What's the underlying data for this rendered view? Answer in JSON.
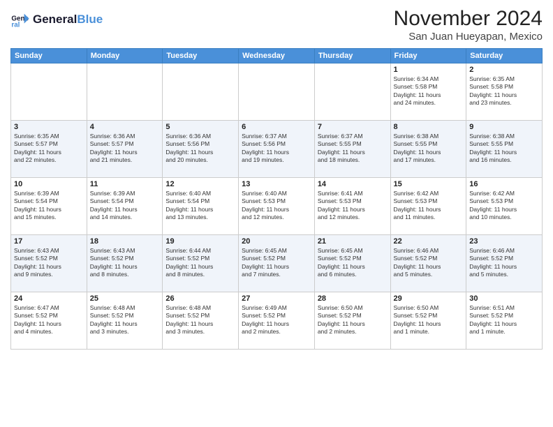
{
  "header": {
    "logo_line1": "General",
    "logo_line2": "Blue",
    "month": "November 2024",
    "location": "San Juan Hueyapan, Mexico"
  },
  "days_of_week": [
    "Sunday",
    "Monday",
    "Tuesday",
    "Wednesday",
    "Thursday",
    "Friday",
    "Saturday"
  ],
  "weeks": [
    [
      {
        "day": "",
        "info": ""
      },
      {
        "day": "",
        "info": ""
      },
      {
        "day": "",
        "info": ""
      },
      {
        "day": "",
        "info": ""
      },
      {
        "day": "",
        "info": ""
      },
      {
        "day": "1",
        "info": "Sunrise: 6:34 AM\nSunset: 5:58 PM\nDaylight: 11 hours\nand 24 minutes."
      },
      {
        "day": "2",
        "info": "Sunrise: 6:35 AM\nSunset: 5:58 PM\nDaylight: 11 hours\nand 23 minutes."
      }
    ],
    [
      {
        "day": "3",
        "info": "Sunrise: 6:35 AM\nSunset: 5:57 PM\nDaylight: 11 hours\nand 22 minutes."
      },
      {
        "day": "4",
        "info": "Sunrise: 6:36 AM\nSunset: 5:57 PM\nDaylight: 11 hours\nand 21 minutes."
      },
      {
        "day": "5",
        "info": "Sunrise: 6:36 AM\nSunset: 5:56 PM\nDaylight: 11 hours\nand 20 minutes."
      },
      {
        "day": "6",
        "info": "Sunrise: 6:37 AM\nSunset: 5:56 PM\nDaylight: 11 hours\nand 19 minutes."
      },
      {
        "day": "7",
        "info": "Sunrise: 6:37 AM\nSunset: 5:55 PM\nDaylight: 11 hours\nand 18 minutes."
      },
      {
        "day": "8",
        "info": "Sunrise: 6:38 AM\nSunset: 5:55 PM\nDaylight: 11 hours\nand 17 minutes."
      },
      {
        "day": "9",
        "info": "Sunrise: 6:38 AM\nSunset: 5:55 PM\nDaylight: 11 hours\nand 16 minutes."
      }
    ],
    [
      {
        "day": "10",
        "info": "Sunrise: 6:39 AM\nSunset: 5:54 PM\nDaylight: 11 hours\nand 15 minutes."
      },
      {
        "day": "11",
        "info": "Sunrise: 6:39 AM\nSunset: 5:54 PM\nDaylight: 11 hours\nand 14 minutes."
      },
      {
        "day": "12",
        "info": "Sunrise: 6:40 AM\nSunset: 5:54 PM\nDaylight: 11 hours\nand 13 minutes."
      },
      {
        "day": "13",
        "info": "Sunrise: 6:40 AM\nSunset: 5:53 PM\nDaylight: 11 hours\nand 12 minutes."
      },
      {
        "day": "14",
        "info": "Sunrise: 6:41 AM\nSunset: 5:53 PM\nDaylight: 11 hours\nand 12 minutes."
      },
      {
        "day": "15",
        "info": "Sunrise: 6:42 AM\nSunset: 5:53 PM\nDaylight: 11 hours\nand 11 minutes."
      },
      {
        "day": "16",
        "info": "Sunrise: 6:42 AM\nSunset: 5:53 PM\nDaylight: 11 hours\nand 10 minutes."
      }
    ],
    [
      {
        "day": "17",
        "info": "Sunrise: 6:43 AM\nSunset: 5:52 PM\nDaylight: 11 hours\nand 9 minutes."
      },
      {
        "day": "18",
        "info": "Sunrise: 6:43 AM\nSunset: 5:52 PM\nDaylight: 11 hours\nand 8 minutes."
      },
      {
        "day": "19",
        "info": "Sunrise: 6:44 AM\nSunset: 5:52 PM\nDaylight: 11 hours\nand 8 minutes."
      },
      {
        "day": "20",
        "info": "Sunrise: 6:45 AM\nSunset: 5:52 PM\nDaylight: 11 hours\nand 7 minutes."
      },
      {
        "day": "21",
        "info": "Sunrise: 6:45 AM\nSunset: 5:52 PM\nDaylight: 11 hours\nand 6 minutes."
      },
      {
        "day": "22",
        "info": "Sunrise: 6:46 AM\nSunset: 5:52 PM\nDaylight: 11 hours\nand 5 minutes."
      },
      {
        "day": "23",
        "info": "Sunrise: 6:46 AM\nSunset: 5:52 PM\nDaylight: 11 hours\nand 5 minutes."
      }
    ],
    [
      {
        "day": "24",
        "info": "Sunrise: 6:47 AM\nSunset: 5:52 PM\nDaylight: 11 hours\nand 4 minutes."
      },
      {
        "day": "25",
        "info": "Sunrise: 6:48 AM\nSunset: 5:52 PM\nDaylight: 11 hours\nand 3 minutes."
      },
      {
        "day": "26",
        "info": "Sunrise: 6:48 AM\nSunset: 5:52 PM\nDaylight: 11 hours\nand 3 minutes."
      },
      {
        "day": "27",
        "info": "Sunrise: 6:49 AM\nSunset: 5:52 PM\nDaylight: 11 hours\nand 2 minutes."
      },
      {
        "day": "28",
        "info": "Sunrise: 6:50 AM\nSunset: 5:52 PM\nDaylight: 11 hours\nand 2 minutes."
      },
      {
        "day": "29",
        "info": "Sunrise: 6:50 AM\nSunset: 5:52 PM\nDaylight: 11 hours\nand 1 minute."
      },
      {
        "day": "30",
        "info": "Sunrise: 6:51 AM\nSunset: 5:52 PM\nDaylight: 11 hours\nand 1 minute."
      }
    ]
  ]
}
